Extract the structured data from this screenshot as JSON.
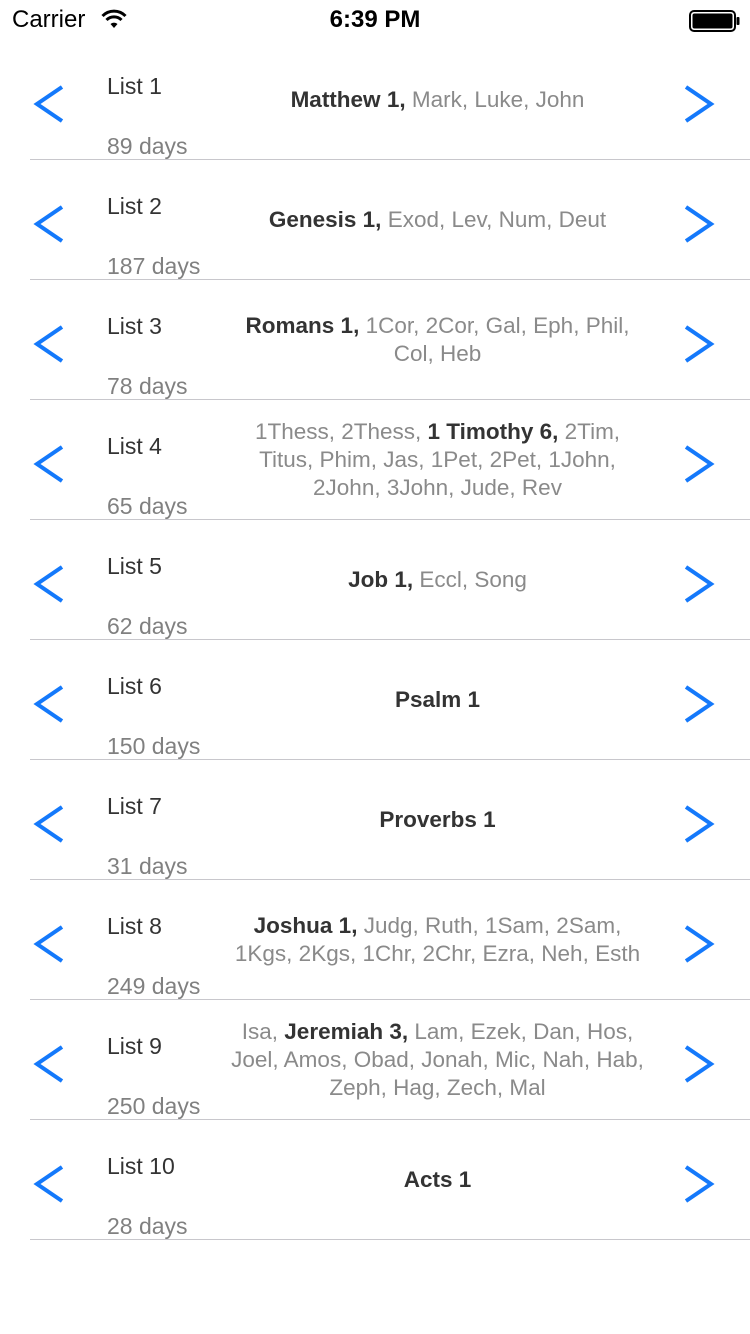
{
  "status_bar": {
    "carrier": "Carrier",
    "time": "6:39 PM"
  },
  "colors": {
    "accent": "#1479fb",
    "divider": "#c8c7cc",
    "current_text": "#333333",
    "muted_text": "#8a8a8a"
  },
  "lists": [
    {
      "name": "List 1",
      "days": "89 days",
      "before": "",
      "current": "Matthew 1,",
      "after": " Mark, Luke, John"
    },
    {
      "name": "List 2",
      "days": "187 days",
      "before": "",
      "current": "Genesis 1,",
      "after": " Exod, Lev, Num, Deut"
    },
    {
      "name": "List 3",
      "days": "78 days",
      "before": "",
      "current": "Romans 1,",
      "after": " 1Cor, 2Cor, Gal, Eph, Phil, Col, Heb"
    },
    {
      "name": "List 4",
      "days": "65 days",
      "before": "1Thess, 2Thess, ",
      "current": "1 Timothy 6,",
      "after": " 2Tim, Titus, Phim, Jas, 1Pet, 2Pet, 1John, 2John, 3John, Jude, Rev"
    },
    {
      "name": "List 5",
      "days": "62 days",
      "before": "",
      "current": "Job 1,",
      "after": " Eccl, Song"
    },
    {
      "name": "List 6",
      "days": "150 days",
      "before": "",
      "current": "Psalm 1",
      "after": ""
    },
    {
      "name": "List 7",
      "days": "31 days",
      "before": "",
      "current": "Proverbs 1",
      "after": ""
    },
    {
      "name": "List 8",
      "days": "249 days",
      "before": "",
      "current": "Joshua 1,",
      "after": " Judg, Ruth, 1Sam, 2Sam, 1Kgs, 2Kgs, 1Chr, 2Chr, Ezra, Neh, Esth"
    },
    {
      "name": "List 9",
      "days": "250 days",
      "before": "Isa, ",
      "current": "Jeremiah 3,",
      "after": " Lam, Ezek, Dan, Hos, Joel, Amos, Obad, Jonah, Mic, Nah, Hab, Zeph, Hag, Zech, Mal"
    },
    {
      "name": "List 10",
      "days": "28 days",
      "before": "",
      "current": "Acts 1",
      "after": ""
    }
  ],
  "icons": {
    "prev": "chevron-left-icon",
    "next": "chevron-right-icon",
    "wifi": "wifi-icon",
    "battery": "battery-icon"
  }
}
